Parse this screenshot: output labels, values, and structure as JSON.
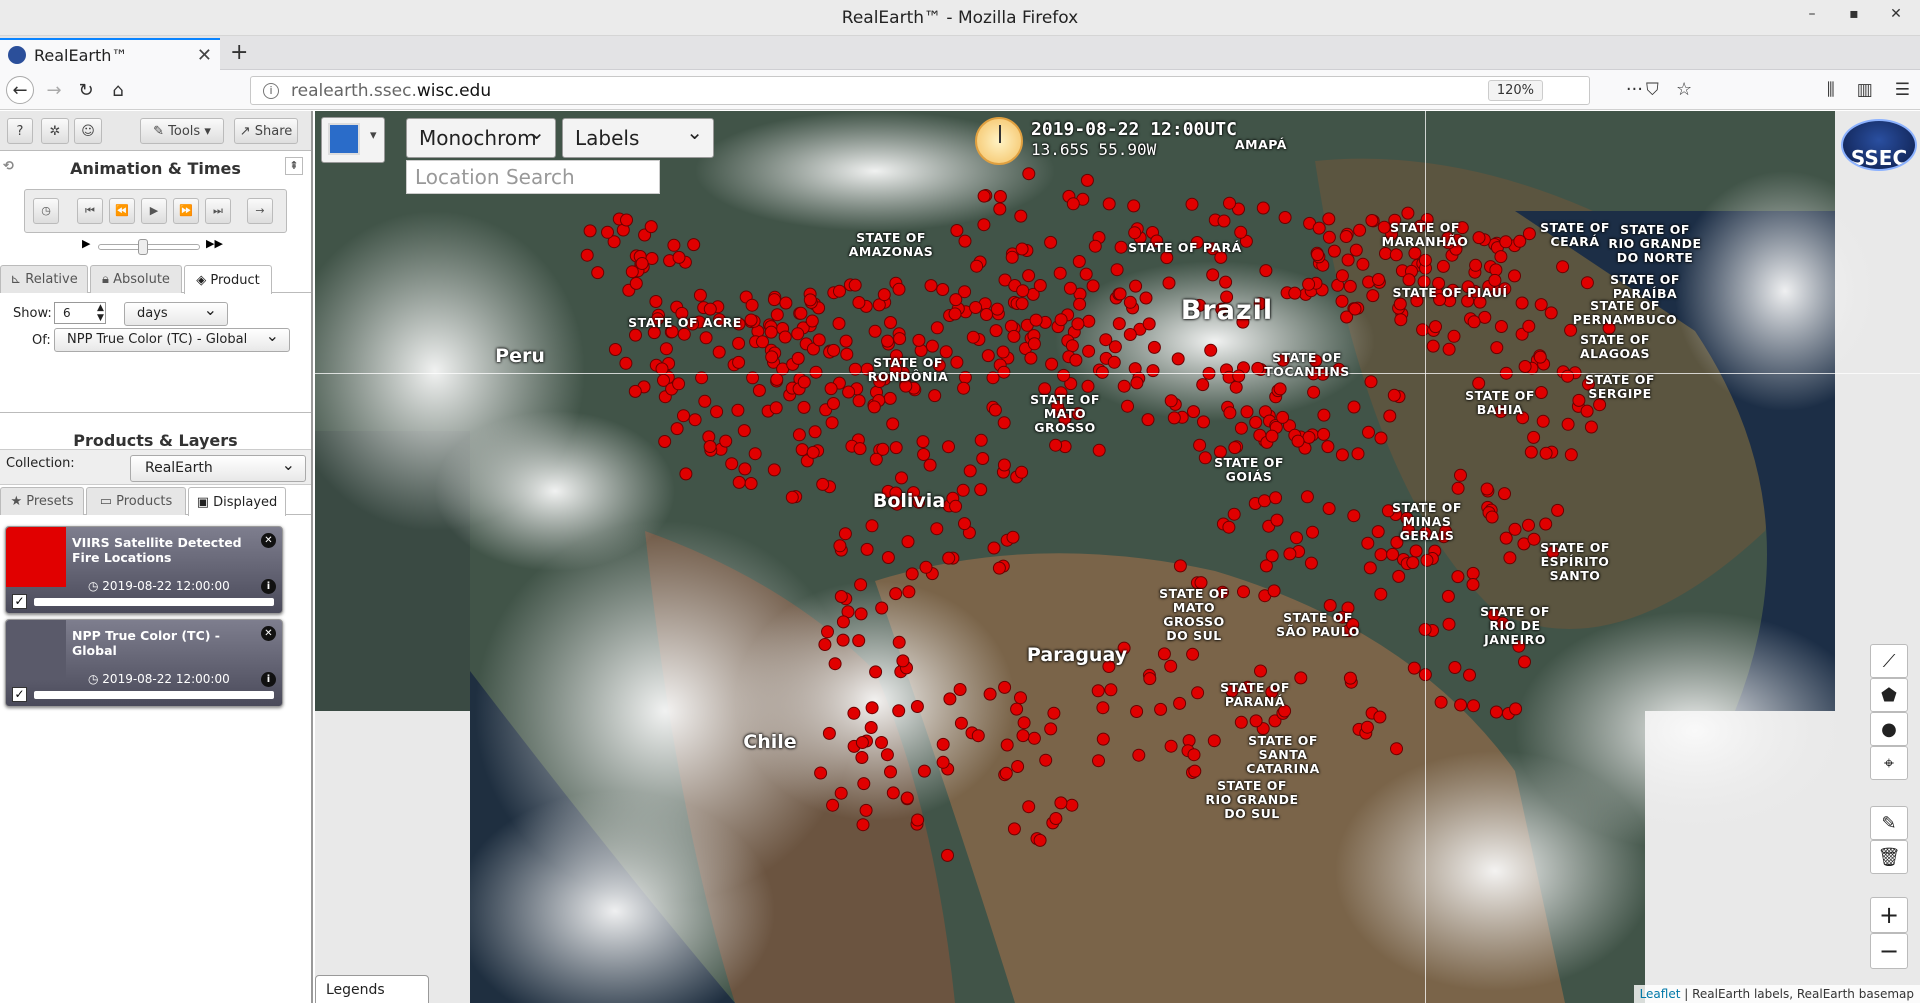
{
  "window": {
    "title": "RealEarth™ - Mozilla Firefox",
    "controls": [
      "–",
      "▪",
      "✕"
    ]
  },
  "browser": {
    "tab_title": "RealEarth™",
    "new_tab": "+",
    "url_prefix": "realearth.ssec.",
    "url_host": "wisc.edu",
    "zoom": "120%"
  },
  "sidebar": {
    "tools_label": "Tools",
    "share_label": "Share",
    "animation_title": "Animation & Times",
    "time_tabs": [
      "Relative",
      "Absolute",
      "Product"
    ],
    "show_label": "Show:",
    "show_value": "6",
    "unit_value": "days",
    "of_label": "Of:",
    "of_value": "NPP True Color (TC) - Global",
    "products_title": "Products & Layers",
    "collection_label": "Collection:",
    "collection_value": "RealEarth",
    "layer_tabs": [
      "Presets",
      "Products",
      "Displayed"
    ],
    "layers": [
      {
        "name": "VIIRS Satellite Detected Fire Locations",
        "time": "2019-08-22 12:00:00",
        "checked": true,
        "thumb_color": "#e10000"
      },
      {
        "name": "NPP True Color (TC) - Global",
        "time": "2019-08-22 12:00:00",
        "checked": true,
        "thumb_color": "#5a5a6a"
      }
    ]
  },
  "map": {
    "basemap_select": "Monochrom",
    "labels_select": "Labels",
    "search_placeholder": "Location Search",
    "datetime": "2019-08-22 12:00UTC",
    "latlon": "13.65S 55.90W",
    "logo_text": "SSEC",
    "legends_label": "Legends",
    "attribution_link": "Leaflet",
    "attribution_text": " | RealEarth labels, RealEarth basemap",
    "fire_color": "#e00000",
    "labels": [
      {
        "text": "STATE OF\nAMAZONAS"
      },
      {
        "text": "STATE OF PARÁ"
      },
      {
        "text": "STATE OF\nMARANHÃO"
      },
      {
        "text": "STATE OF\nCEARÁ"
      },
      {
        "text": "STATE OF\nRIO GRANDE\nDO NORTE"
      },
      {
        "text": "STATE OF\nPARAÍBA"
      },
      {
        "text": "STATE OF\nPERNAMBUCO"
      },
      {
        "text": "STATE OF\nALAGOAS"
      },
      {
        "text": "STATE OF\nSERGIPE"
      },
      {
        "text": "STATE OF PIAUÍ"
      },
      {
        "text": "STATE OF\nBAHIA"
      },
      {
        "text": "Brazil"
      },
      {
        "text": "STATE OF ACRE"
      },
      {
        "text": "Peru"
      },
      {
        "text": "STATE OF\nRONDÔNIA"
      },
      {
        "text": "STATE OF\nMATO\nGROSSO"
      },
      {
        "text": "STATE OF\nTOCANTINS"
      },
      {
        "text": "STATE OF\nGOIÁS"
      },
      {
        "text": "Bolivia"
      },
      {
        "text": "STATE OF\nMINAS\nGERAIS"
      },
      {
        "text": "STATE OF\nESPÍRITO\nSANTO"
      },
      {
        "text": "STATE OF\nMATO\nGROSSO\nDO SUL"
      },
      {
        "text": "STATE OF\nSÃO PAULO"
      },
      {
        "text": "STATE OF\nRIO DE\nJANEIRO"
      },
      {
        "text": "Paraguay"
      },
      {
        "text": "STATE OF\nPARANÁ"
      },
      {
        "text": "STATE OF\nSANTA\nCATARINA"
      },
      {
        "text": "Chile"
      },
      {
        "text": "STATE OF\nRIO GRANDE\nDO SUL"
      },
      {
        "text": "AMAPÁ"
      }
    ]
  }
}
